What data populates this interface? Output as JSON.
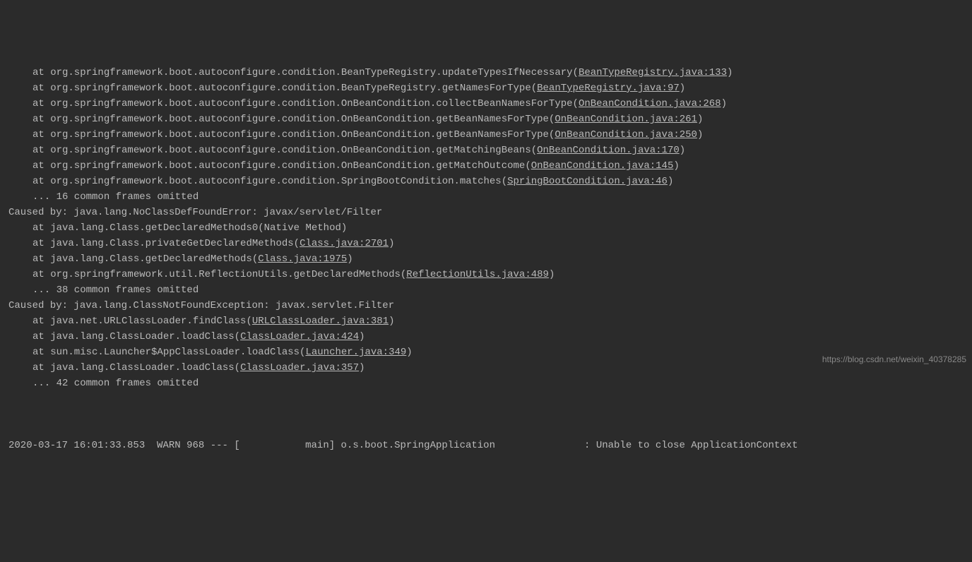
{
  "stack": [
    {
      "indent": 1,
      "prefix": "at ",
      "method": "org.springframework.boot.autoconfigure.condition.BeanTypeRegistry.updateTypesIfNecessary",
      "link": "BeanTypeRegistry.java:133"
    },
    {
      "indent": 1,
      "prefix": "at ",
      "method": "org.springframework.boot.autoconfigure.condition.BeanTypeRegistry.getNamesForType",
      "link": "BeanTypeRegistry.java:97"
    },
    {
      "indent": 1,
      "prefix": "at ",
      "method": "org.springframework.boot.autoconfigure.condition.OnBeanCondition.collectBeanNamesForType",
      "link": "OnBeanCondition.java:268"
    },
    {
      "indent": 1,
      "prefix": "at ",
      "method": "org.springframework.boot.autoconfigure.condition.OnBeanCondition.getBeanNamesForType",
      "link": "OnBeanCondition.java:261"
    },
    {
      "indent": 1,
      "prefix": "at ",
      "method": "org.springframework.boot.autoconfigure.condition.OnBeanCondition.getBeanNamesForType",
      "link": "OnBeanCondition.java:250"
    },
    {
      "indent": 1,
      "prefix": "at ",
      "method": "org.springframework.boot.autoconfigure.condition.OnBeanCondition.getMatchingBeans",
      "link": "OnBeanCondition.java:170"
    },
    {
      "indent": 1,
      "prefix": "at ",
      "method": "org.springframework.boot.autoconfigure.condition.OnBeanCondition.getMatchOutcome",
      "link": "OnBeanCondition.java:145"
    },
    {
      "indent": 1,
      "prefix": "at ",
      "method": "org.springframework.boot.autoconfigure.condition.SpringBootCondition.matches",
      "link": "SpringBootCondition.java:46"
    },
    {
      "indent": 1,
      "plain": "... 16 common frames omitted"
    },
    {
      "indent": 0,
      "plain": "Caused by: java.lang.NoClassDefFoundError: javax/servlet/Filter"
    },
    {
      "indent": 1,
      "plain": "at java.lang.Class.getDeclaredMethods0(Native Method)"
    },
    {
      "indent": 1,
      "prefix": "at ",
      "method": "java.lang.Class.privateGetDeclaredMethods",
      "link": "Class.java:2701"
    },
    {
      "indent": 1,
      "prefix": "at ",
      "method": "java.lang.Class.getDeclaredMethods",
      "link": "Class.java:1975"
    },
    {
      "indent": 1,
      "prefix": "at ",
      "method": "org.springframework.util.ReflectionUtils.getDeclaredMethods",
      "link": "ReflectionUtils.java:489"
    },
    {
      "indent": 1,
      "plain": "... 38 common frames omitted"
    },
    {
      "indent": 0,
      "plain": "Caused by: java.lang.ClassNotFoundException: javax.servlet.Filter"
    },
    {
      "indent": 1,
      "prefix": "at ",
      "method": "java.net.URLClassLoader.findClass",
      "link": "URLClassLoader.java:381"
    },
    {
      "indent": 1,
      "prefix": "at ",
      "method": "java.lang.ClassLoader.loadClass",
      "link": "ClassLoader.java:424"
    },
    {
      "indent": 1,
      "prefix": "at ",
      "method": "sun.misc.Launcher$AppClassLoader.loadClass",
      "link": "Launcher.java:349"
    },
    {
      "indent": 1,
      "prefix": "at ",
      "method": "java.lang.ClassLoader.loadClass",
      "link": "ClassLoader.java:357"
    },
    {
      "indent": 1,
      "plain": "... 42 common frames omitted"
    }
  ],
  "logline": {
    "timestamp": "2020-03-17 16:01:33.853",
    "level": "WARN",
    "pid": "968",
    "sep": "---",
    "thread": "[           main]",
    "logger": "o.s.boot.SpringApplication",
    "colon": ":",
    "message": "Unable to close ApplicationContext"
  },
  "watermark": "https://blog.csdn.net/weixin_40378285"
}
